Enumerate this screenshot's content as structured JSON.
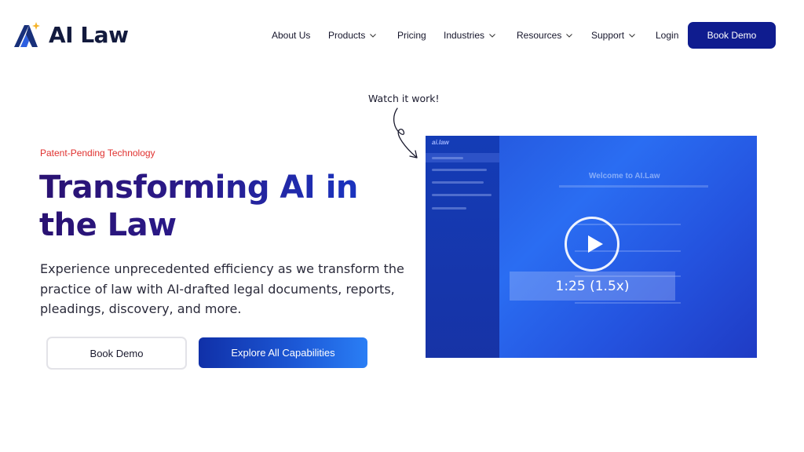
{
  "brand": {
    "name": "AI Law"
  },
  "nav": {
    "items": [
      {
        "label": "About Us",
        "has_dropdown": false
      },
      {
        "label": "Products",
        "has_dropdown": true
      },
      {
        "label": "Pricing",
        "has_dropdown": false
      },
      {
        "label": "Industries",
        "has_dropdown": true
      },
      {
        "label": "Resources",
        "has_dropdown": true
      },
      {
        "label": "Support",
        "has_dropdown": true
      },
      {
        "label": "Login",
        "has_dropdown": false
      }
    ],
    "cta_label": "Book Demo"
  },
  "hero": {
    "eyebrow": "Patent-Pending Technology",
    "title_line1": "Transforming AI in",
    "title_line2": "the Law",
    "subtitle": "Experience unprecedented efficiency as we transform the practice of law with AI-drafted legal documents, reports, pleadings, discovery, and more.",
    "primary_cta": "Book Demo",
    "secondary_cta": "Explore All Capabilities"
  },
  "video": {
    "callout": "Watch it work!",
    "duration_label": "1:25 (1.5x)",
    "preview_logo": "ai.law",
    "preview_heading": "Welcome to AI.Law"
  },
  "colors": {
    "primary": "#0f1c8f",
    "accent_red": "#e0312f",
    "gradient_blue": "#2a7ef5"
  }
}
